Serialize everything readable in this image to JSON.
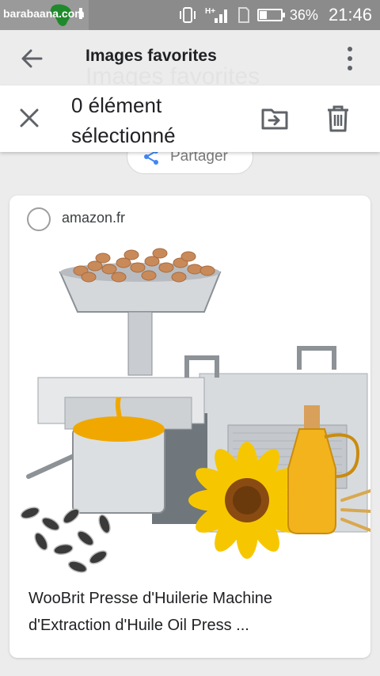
{
  "status_bar": {
    "watermark_text": "barabaana.com",
    "network": "H+",
    "battery_percent": "36%",
    "battery_level": 0.36,
    "time": "21:46"
  },
  "app_bar": {
    "title": "Images favorites",
    "back_icon": "arrow-left-icon",
    "menu_icon": "more-vert-icon"
  },
  "background_title": "Images favorites",
  "selection_bar": {
    "count_label": "0 élément sélectionné",
    "close_icon": "close-icon",
    "move_icon": "move-to-folder-icon",
    "delete_icon": "trash-icon"
  },
  "share": {
    "label": "Partager",
    "icon": "share-icon"
  },
  "card": {
    "source": "amazon.fr",
    "caption": "WooBrit Presse d'Huilerie Machine d'Extraction d'Huile Oil Press ...",
    "selected": false
  },
  "colors": {
    "status_bar": "#8b8b8b",
    "app_bar": "#ececec",
    "share_icon": "#4285f4",
    "sunflower": "#f6c700",
    "oil": "#f0a800"
  }
}
